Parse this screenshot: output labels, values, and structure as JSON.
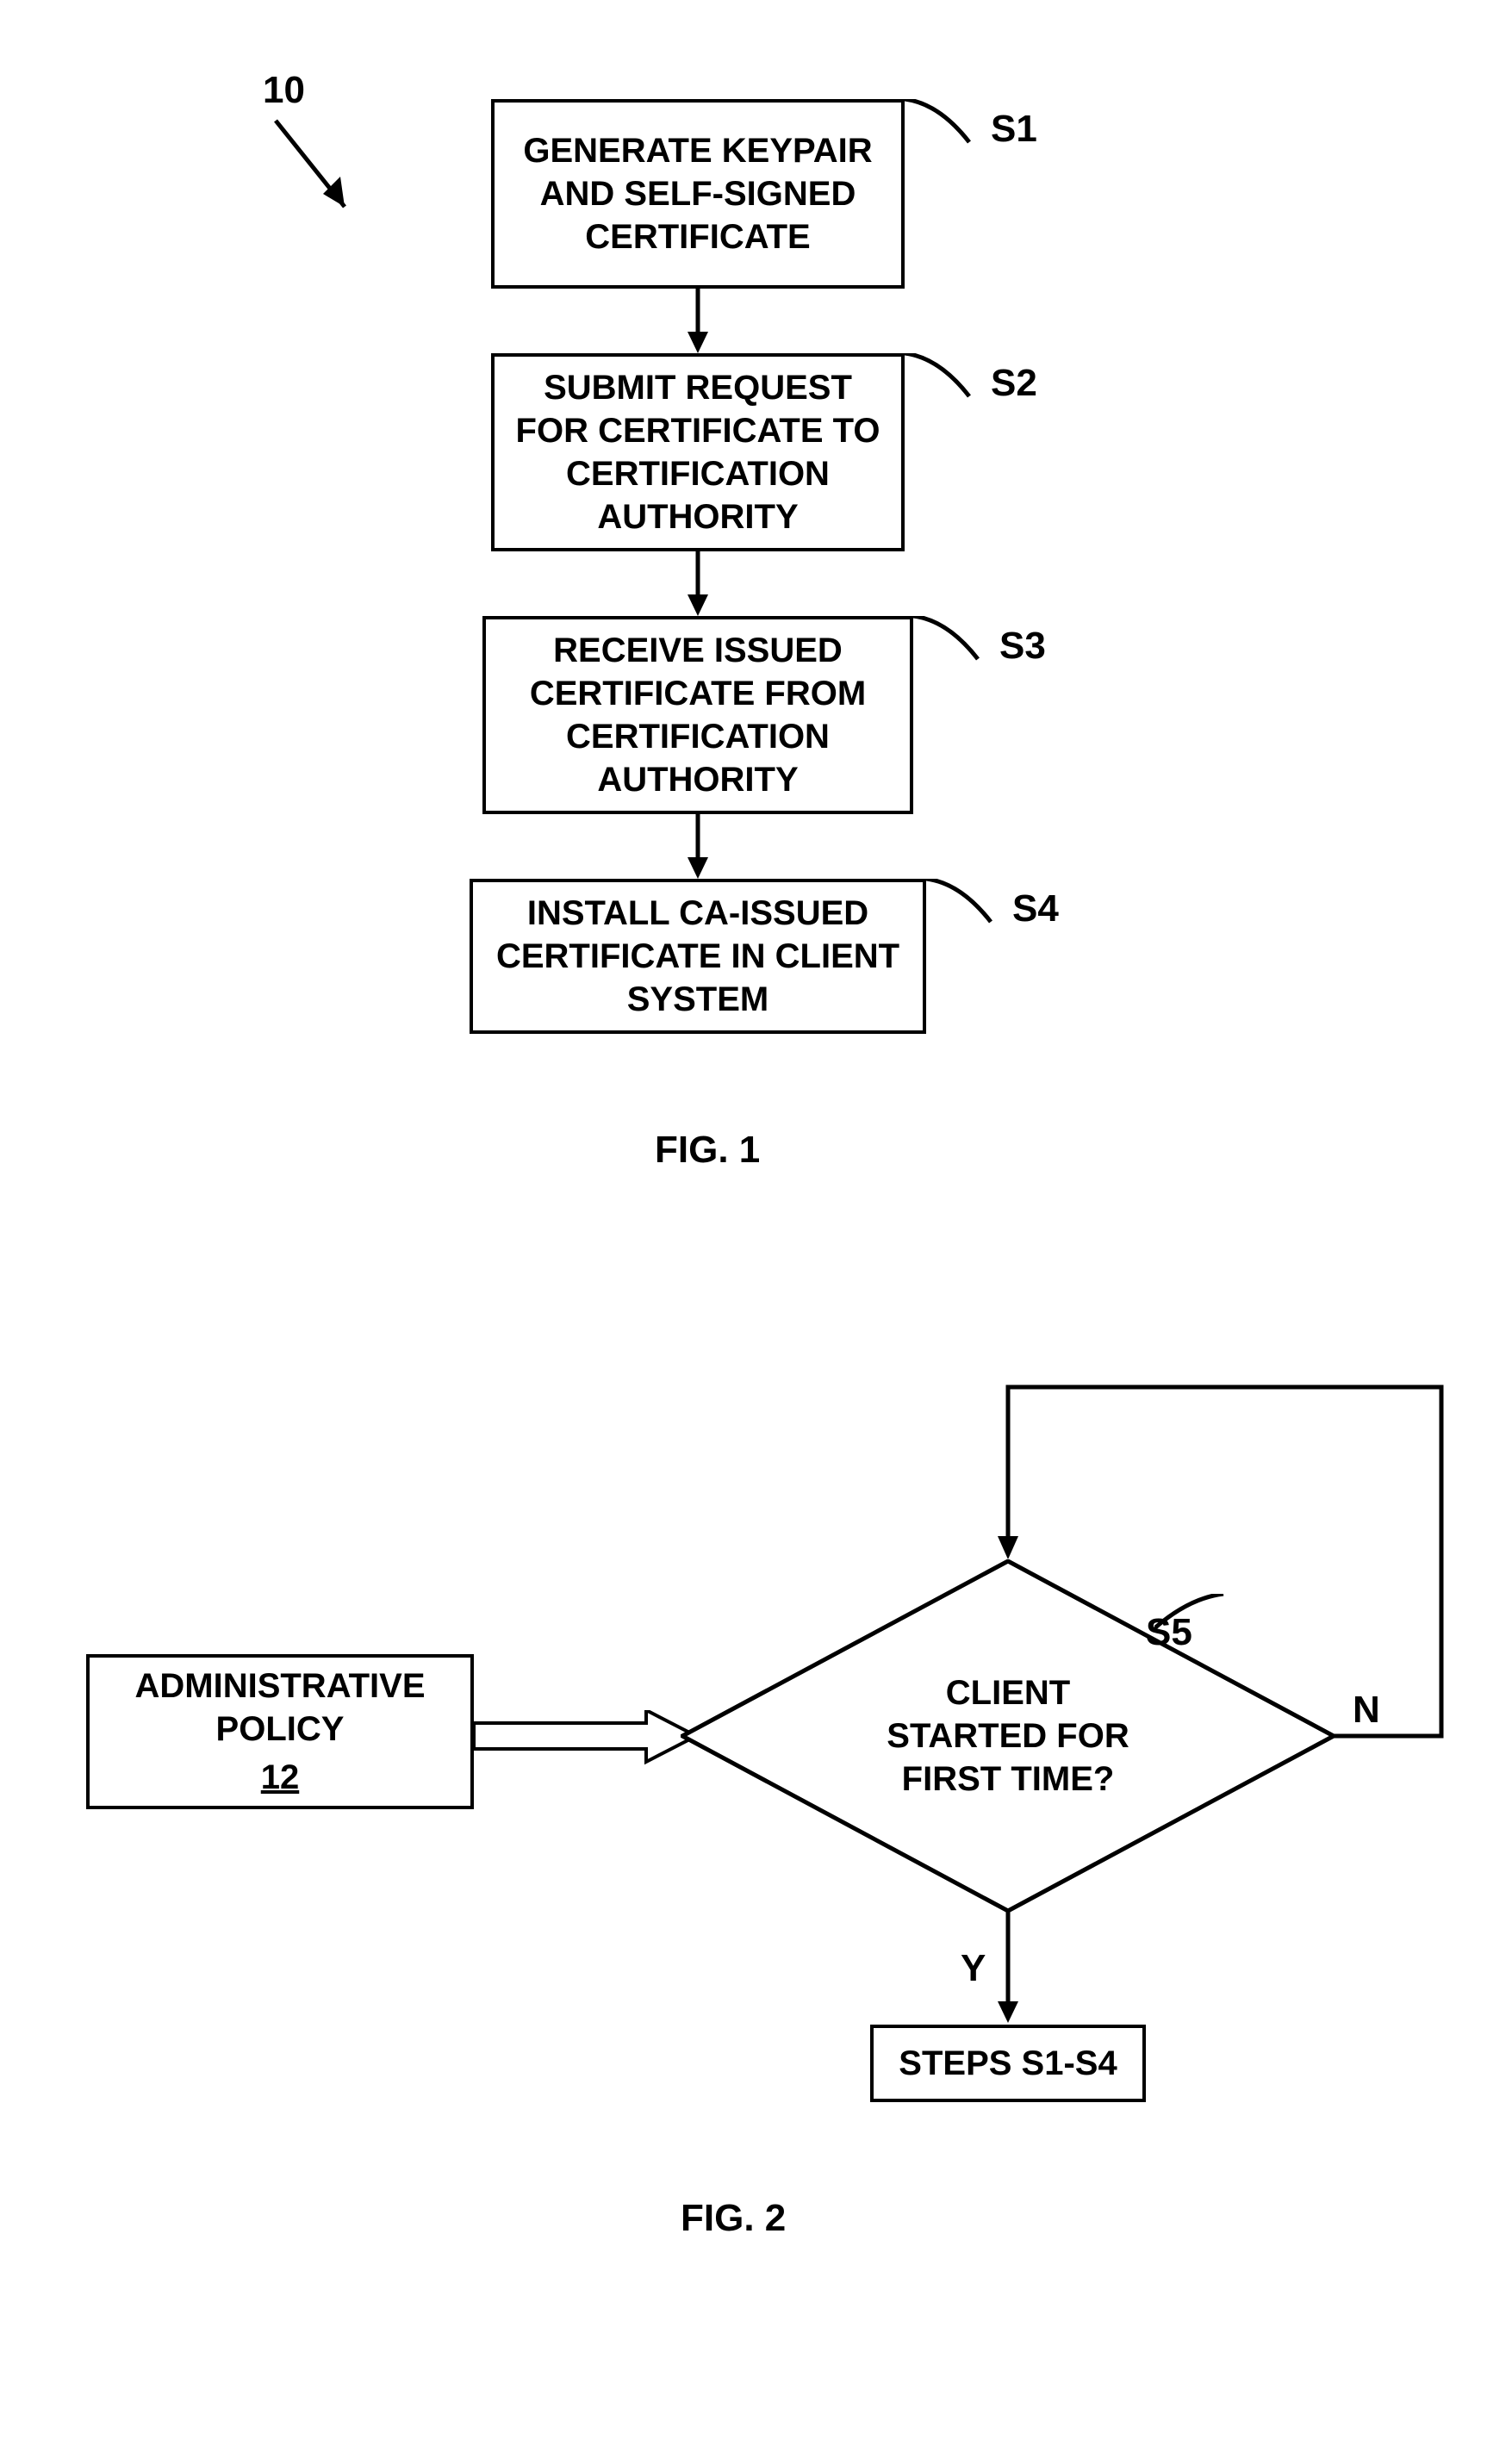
{
  "fig1": {
    "ref": "10",
    "steps": {
      "s1": {
        "label": "S1",
        "text": "GENERATE KEYPAIR AND SELF-SIGNED CERTIFICATE"
      },
      "s2": {
        "label": "S2",
        "text": "SUBMIT REQUEST FOR CERTIFICATE TO CERTIFICATION AUTHORITY"
      },
      "s3": {
        "label": "S3",
        "text": "RECEIVE ISSUED CERTIFICATE FROM CERTIFICATION AUTHORITY"
      },
      "s4": {
        "label": "S4",
        "text": "INSTALL CA-ISSUED CERTIFICATE IN CLIENT SYSTEM"
      }
    },
    "caption": "FIG. 1"
  },
  "fig2": {
    "admin_policy": {
      "text": "ADMINISTRATIVE POLICY",
      "ref": "12"
    },
    "decision": {
      "label": "S5",
      "text": "CLIENT STARTED FOR FIRST TIME?",
      "yes": "Y",
      "no": "N"
    },
    "steps_box": {
      "text": "STEPS S1-S4"
    },
    "caption": "FIG. 2"
  }
}
